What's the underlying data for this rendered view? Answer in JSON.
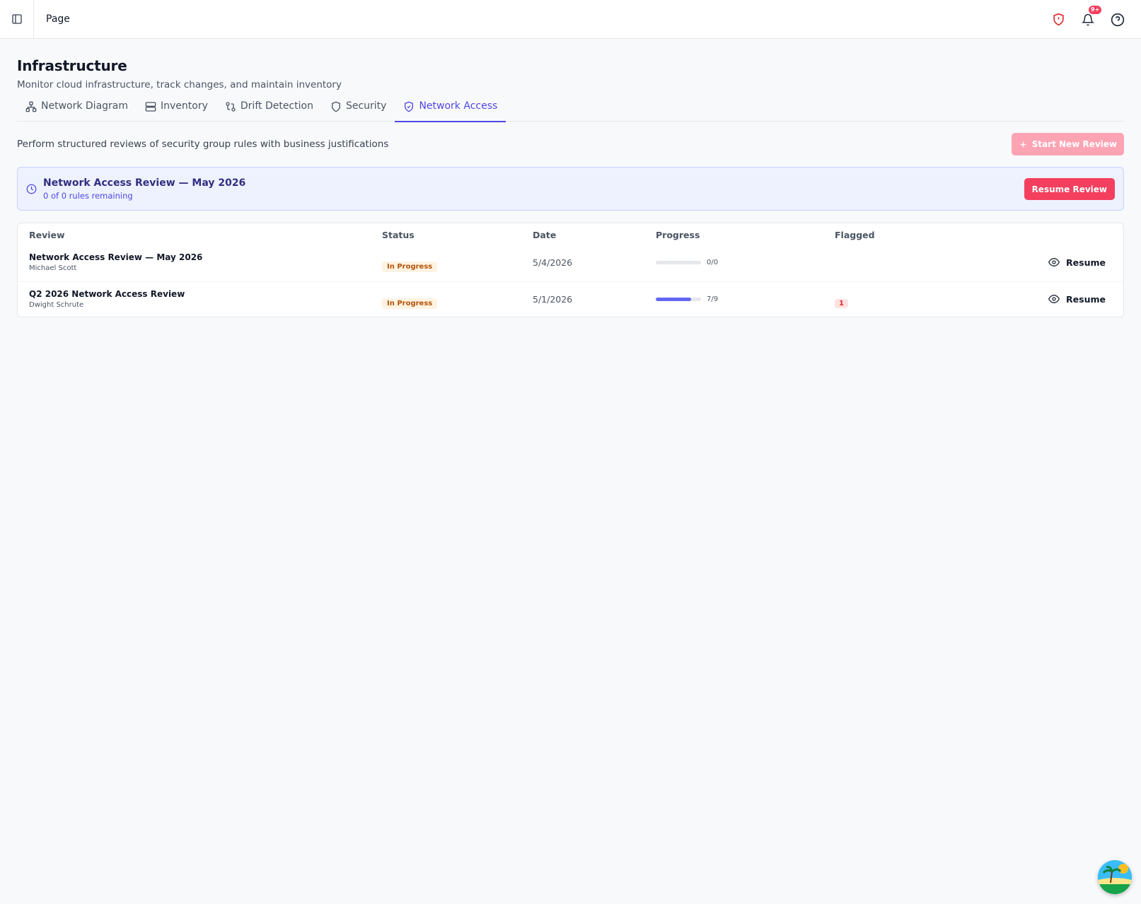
{
  "topbar": {
    "title": "Page",
    "notification_count": "9+"
  },
  "header": {
    "title": "Infrastructure",
    "subtitle": "Monitor cloud infrastructure, track changes, and maintain inventory"
  },
  "tabs": [
    {
      "label": "Network Diagram",
      "icon": "network-icon"
    },
    {
      "label": "Inventory",
      "icon": "server-icon"
    },
    {
      "label": "Drift Detection",
      "icon": "git-compare-icon"
    },
    {
      "label": "Security",
      "icon": "shield-icon"
    },
    {
      "label": "Network Access",
      "icon": "shield-check-icon",
      "active": true
    }
  ],
  "toolbar": {
    "description": "Perform structured reviews of security group rules with business justifications",
    "start_label": "Start New Review"
  },
  "active_review": {
    "title": "Network Access Review — May 2026",
    "subtitle": "0 of 0 rules remaining",
    "button_label": "Resume Review"
  },
  "table": {
    "columns": [
      "Review",
      "Status",
      "Date",
      "Progress",
      "Flagged"
    ],
    "rows": [
      {
        "name": "Network Access Review — May 2026",
        "owner": "Michael Scott",
        "status": "In Progress",
        "date": "5/4/2026",
        "progress_done": 0,
        "progress_total": 0,
        "progress_text": "0/0",
        "flagged": "",
        "action": "Resume"
      },
      {
        "name": "Q2 2026 Network Access Review",
        "owner": "Dwight Schrute",
        "status": "In Progress",
        "date": "5/1/2026",
        "progress_done": 7,
        "progress_total": 9,
        "progress_text": "7/9",
        "flagged": "1",
        "action": "Resume"
      }
    ]
  },
  "colors": {
    "accent": "#4f46e5",
    "primary_button": "#f43f5e",
    "alert": "#dc2626"
  }
}
